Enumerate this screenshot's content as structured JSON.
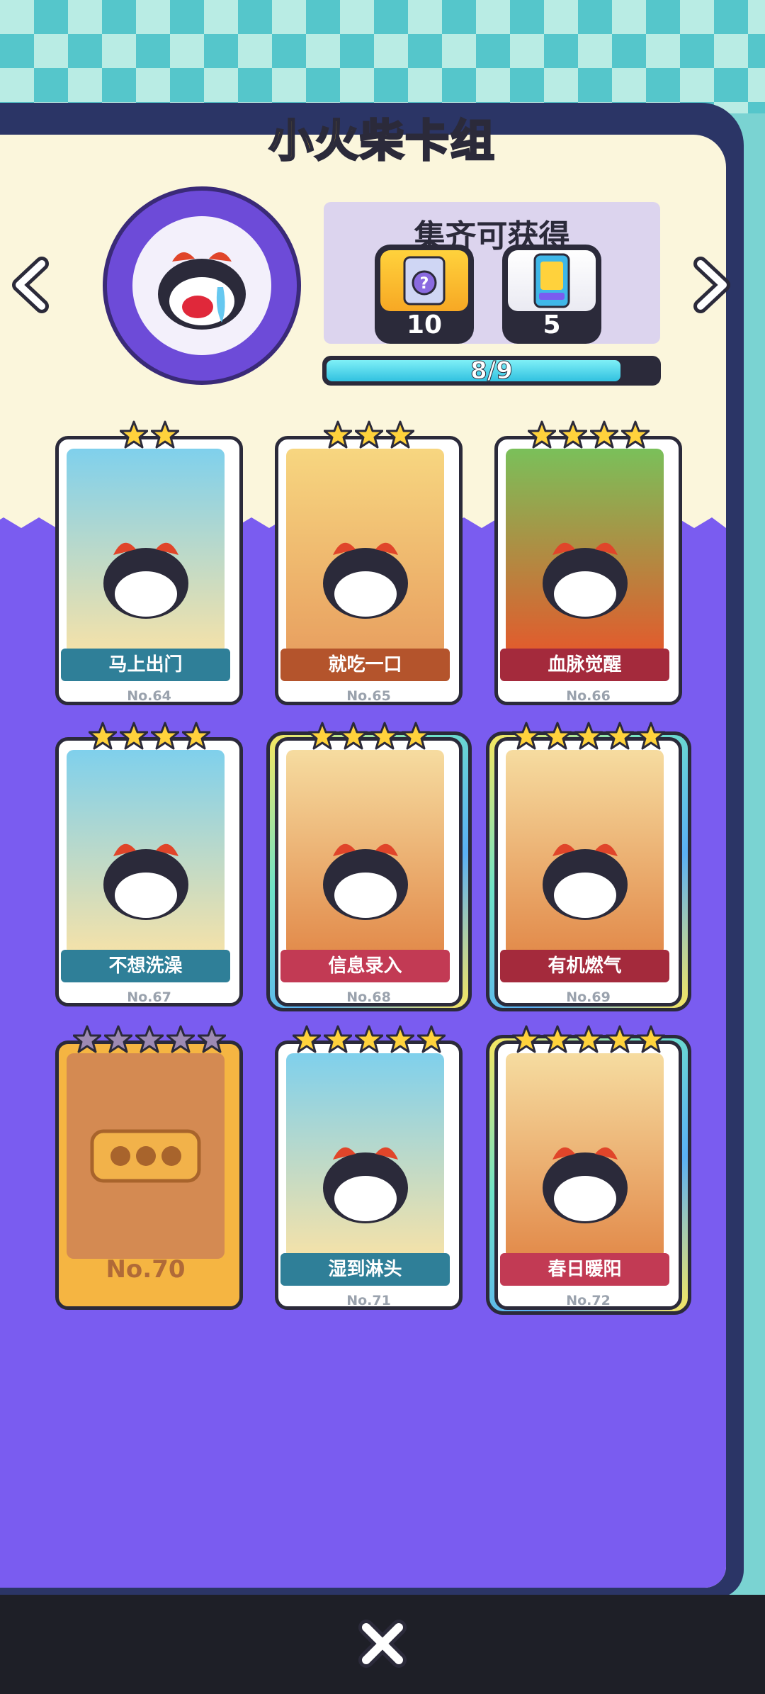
{
  "header": {
    "title": "小火柴卡组"
  },
  "nav": {
    "prev_icon": "chevron-left-icon",
    "next_icon": "chevron-right-icon"
  },
  "reward": {
    "title": "集齐可获得",
    "items": [
      {
        "icon": "mystery-pack-icon",
        "count": "10"
      },
      {
        "icon": "card-pack-icon",
        "count": "5"
      }
    ],
    "progress_text": "8/9",
    "progress_fraction": 0.89
  },
  "cards": [
    {
      "title": "马上出门",
      "no": "No.64",
      "stars": 2,
      "style": "blue",
      "ribbon_color": "#2f7f98"
    },
    {
      "title": "就吃一口",
      "no": "No.65",
      "stars": 3,
      "style": "orange",
      "ribbon_color": "#b4542c"
    },
    {
      "title": "血脉觉醒",
      "no": "No.66",
      "stars": 4,
      "style": "red",
      "ribbon_color": "#a42a3c"
    },
    {
      "title": "不想洗澡",
      "no": "No.67",
      "stars": 4,
      "style": "blue",
      "ribbon_color": "#2f7f98"
    },
    {
      "title": "信息录入",
      "no": "No.68",
      "stars": 4,
      "style": "holo",
      "ribbon_color": "#c23a54"
    },
    {
      "title": "有机燃气",
      "no": "No.69",
      "stars": 5,
      "style": "holo",
      "ribbon_color": "#a42a3c"
    },
    {
      "title": "",
      "no": "No.70",
      "stars": 5,
      "style": "locked",
      "ribbon_color": "#d08a50"
    },
    {
      "title": "湿到淋头",
      "no": "No.71",
      "stars": 5,
      "style": "blue",
      "ribbon_color": "#2f7f98"
    },
    {
      "title": "春日暖阳",
      "no": "No.72",
      "stars": 5,
      "style": "holo",
      "ribbon_color": "#c23a54"
    }
  ],
  "colors": {
    "panel": "#fbf6dc",
    "purple_bg": "#7a5cf0",
    "title_yellow": "#ffd23c",
    "progress_cyan": "#31c1e0"
  },
  "close": {
    "icon": "close-icon"
  }
}
